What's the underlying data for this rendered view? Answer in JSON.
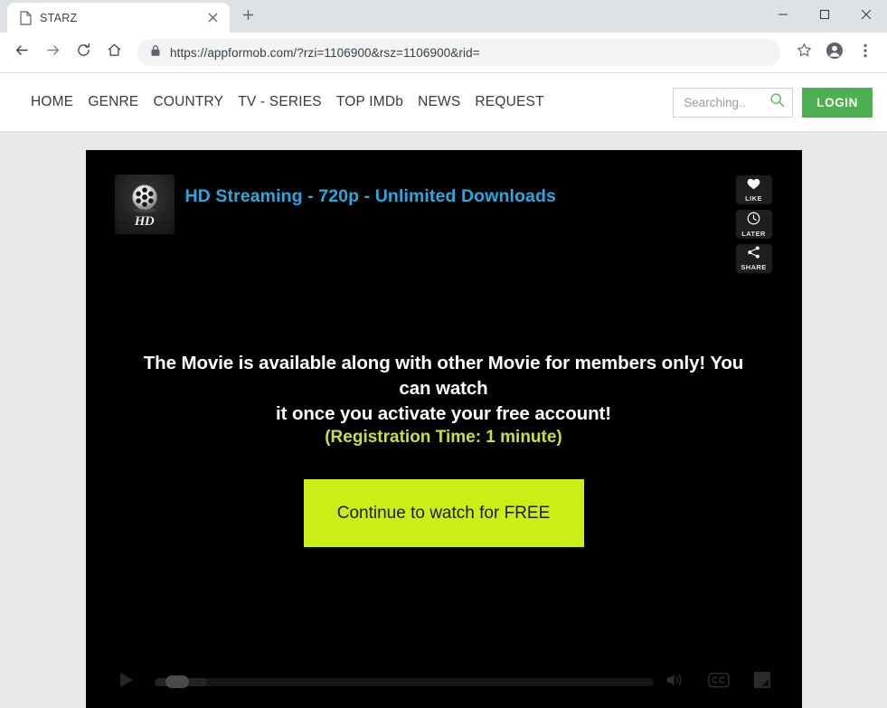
{
  "browser": {
    "tab": {
      "title": "STARZ",
      "favicon_icon": "page-icon",
      "close_icon": "close-icon"
    },
    "newtab_icon": "plus-icon",
    "window_controls": {
      "minimize_icon": "minimize-icon",
      "maximize_icon": "maximize-icon",
      "close_icon": "close-icon"
    },
    "toolbar": {
      "back_icon": "arrow-left-icon",
      "forward_icon": "arrow-right-icon",
      "reload_icon": "reload-icon",
      "home_icon": "home-icon",
      "lock_icon": "lock-icon",
      "url": "https://appformob.com/?rzi=1106900&rsz=1106900&rid=",
      "bookmark_icon": "star-icon",
      "profile_icon": "account-avatar-icon",
      "menu_icon": "three-dot-menu-icon"
    }
  },
  "site": {
    "nav_items": [
      {
        "label": "HOME"
      },
      {
        "label": "GENRE"
      },
      {
        "label": "COUNTRY"
      },
      {
        "label": "TV - SERIES"
      },
      {
        "label": "TOP IMDb"
      },
      {
        "label": "NEWS"
      },
      {
        "label": "REQUEST"
      }
    ],
    "search": {
      "placeholder": "Searching..",
      "value": "",
      "icon": "search-icon"
    },
    "login_label": "LOGIN",
    "colors": {
      "accent_green": "#4caf50",
      "cta_green": "#ccee14",
      "title_blue": "#2aa9e0",
      "sub_yellow": "#c6e03c"
    }
  },
  "player": {
    "title": "HD Streaming - 720p - Unlimited Downloads",
    "thumbnail": {
      "icon": "film-reel-icon",
      "badge": "HD"
    },
    "actions": [
      {
        "label": "LIKE",
        "icon": "heart-icon"
      },
      {
        "label": "LATER",
        "icon": "clock-icon"
      },
      {
        "label": "SHARE",
        "icon": "share-nodes-icon"
      }
    ],
    "message_line1": "The Movie is available along with other Movie for members only! You can watch",
    "message_line2": "it once you activate your free account!",
    "registration_note": "(Registration Time: 1 minute)",
    "cta_label": "Continue to watch for FREE",
    "controls": {
      "play_icon": "play-icon",
      "volume_icon": "volume-icon",
      "captions_icon": "closed-captions-icon",
      "fullscreen_icon": "fullscreen-icon"
    }
  }
}
